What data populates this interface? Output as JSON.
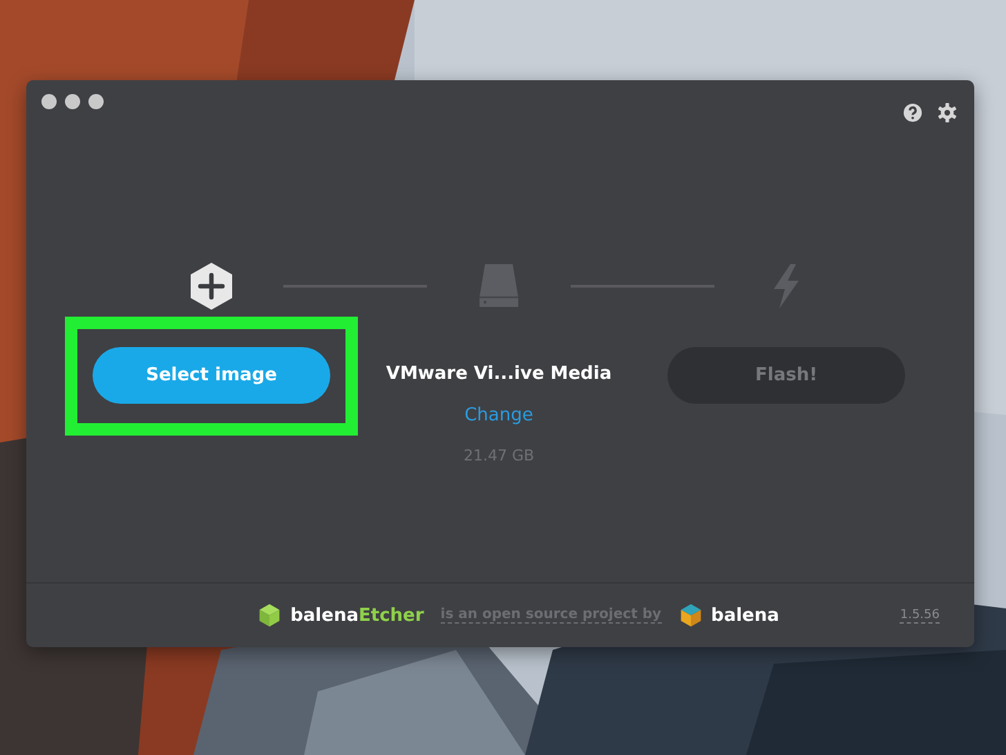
{
  "steps": [
    {
      "active": true,
      "button": "Select image",
      "highlighted": true
    },
    {
      "kind": "drive",
      "active": false,
      "name": "VMware Vi...ive Media",
      "action": "Change",
      "size": "21.47 GB"
    },
    {
      "kind": "flash",
      "active": false,
      "button": "Flash!",
      "disabled": true
    }
  ],
  "footer": {
    "logo_prefix": "balena",
    "logo_suffix": "Etcher",
    "tagline": "is an open source project by",
    "company": "balena",
    "version": "1.5.56"
  }
}
